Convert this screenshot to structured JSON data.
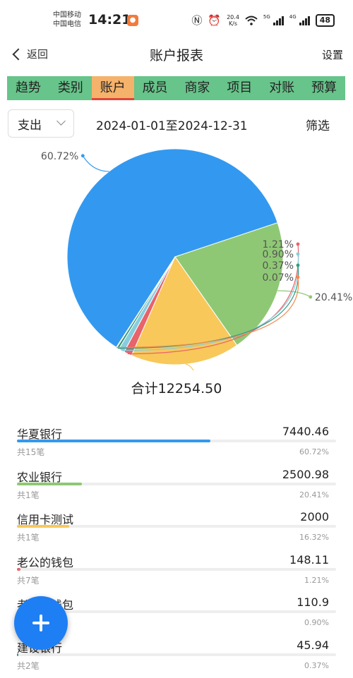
{
  "status_bar": {
    "carrier_1": "中国移动",
    "carrier_2": "中国电信",
    "time": "14:21",
    "speed_value": "20.4",
    "speed_unit": "K/s",
    "net_1": "5G",
    "net_2": "4G",
    "battery": "48",
    "icons": [
      "nfc-icon",
      "alarm-icon",
      "wifi-icon",
      "signal-icon",
      "battery-icon"
    ]
  },
  "nav": {
    "back_label": "返回",
    "title": "账户报表",
    "settings_label": "设置"
  },
  "tabs": [
    {
      "label": "趋势",
      "active": false
    },
    {
      "label": "类别",
      "active": false
    },
    {
      "label": "账户",
      "active": true
    },
    {
      "label": "成员",
      "active": false
    },
    {
      "label": "商家",
      "active": false
    },
    {
      "label": "项目",
      "active": false
    },
    {
      "label": "对账",
      "active": false
    },
    {
      "label": "预算",
      "active": false
    }
  ],
  "filter": {
    "type_value": "支出",
    "date_range": "2024-01-01至2024-12-31",
    "filter_label": "筛选"
  },
  "chart_data": {
    "type": "pie",
    "slices": [
      {
        "label": "60.72%",
        "value": 60.72,
        "color": "#3399f0"
      },
      {
        "label": "20.41%",
        "value": 20.41,
        "color": "#8fc874"
      },
      {
        "label": "16.32%",
        "value": 16.32,
        "color": "#f8c85a"
      },
      {
        "label": "1.21%",
        "value": 1.21,
        "color": "#e8636a"
      },
      {
        "label": "0.90%",
        "value": 0.9,
        "color": "#86cddf"
      },
      {
        "label": "0.37%",
        "value": 0.37,
        "color": "#389b7f"
      },
      {
        "label": "0.07%",
        "value": 0.07,
        "color": "#f28a50"
      }
    ]
  },
  "summary": {
    "total_label": "合计12254.50"
  },
  "accounts": [
    {
      "name": "华夏银行",
      "amount": "7440.46",
      "count": "共15笔",
      "percent": "60.72%",
      "ratio": 0.6072,
      "color": "#3399f0"
    },
    {
      "name": "农业银行",
      "amount": "2500.98",
      "count": "共1笔",
      "percent": "20.41%",
      "ratio": 0.2041,
      "color": "#8fc874"
    },
    {
      "name": "信用卡测试",
      "amount": "2000",
      "count": "共1笔",
      "percent": "16.32%",
      "ratio": 0.1632,
      "color": "#f8c85a"
    },
    {
      "name": "老公的钱包",
      "amount": "148.11",
      "count": "共7笔",
      "percent": "1.21%",
      "ratio": 0.0121,
      "color": "#e8636a"
    },
    {
      "name": "老婆的钱包",
      "amount": "110.9",
      "count": "",
      "percent": "0.90%",
      "ratio": 0.009,
      "color": "#86cddf"
    },
    {
      "name": "建设银行",
      "amount": "45.94",
      "count": "共2笔",
      "percent": "0.37%",
      "ratio": 0.0037,
      "color": "#389b7f"
    }
  ]
}
